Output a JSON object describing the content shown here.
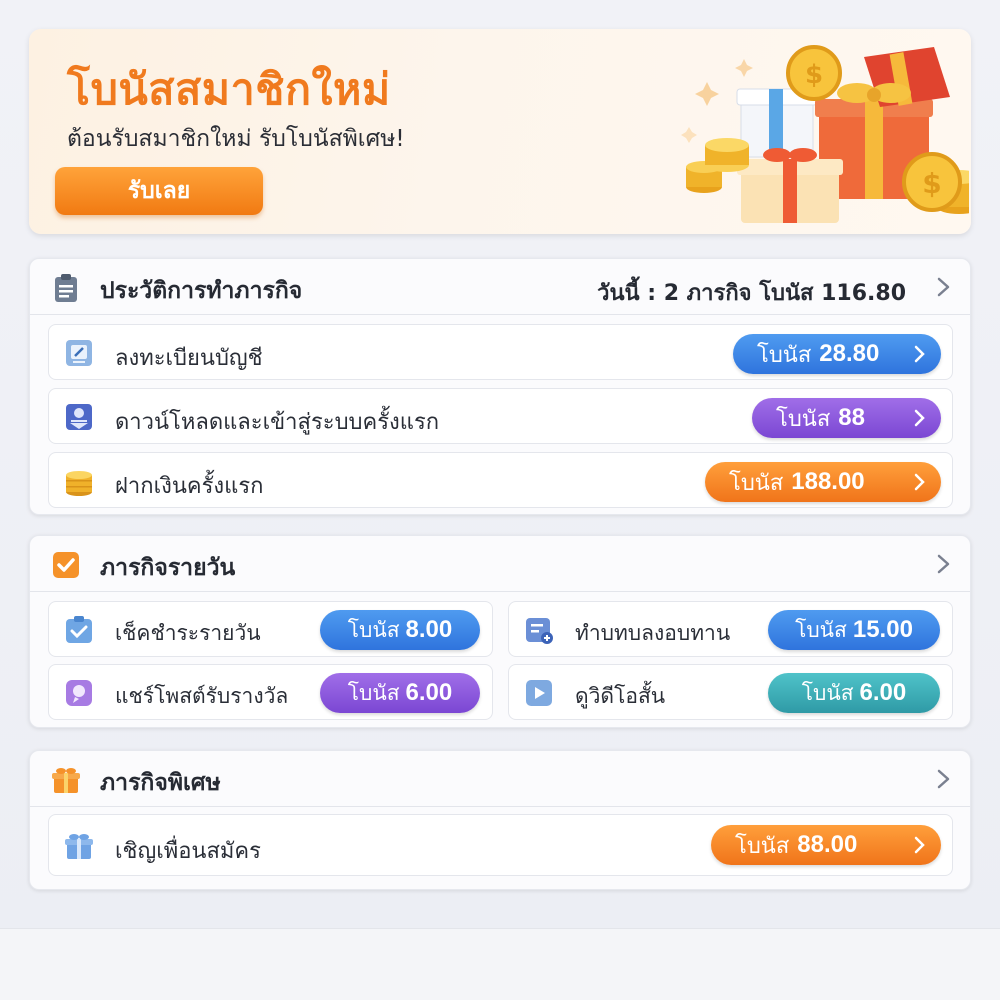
{
  "banner": {
    "title": "โบนัสสมาชิกใหม่",
    "subtitle": "ต้อนรับสมาชิกใหม่ รับโบนัสพิเศษ!",
    "claim_label": "รับเลย"
  },
  "history": {
    "title": "ประวัติการทำภารกิจ",
    "summary": "วันนี้ : 2 ภารกิจ โบนัส 116.80",
    "items": [
      {
        "label": "ลงทะเบียนบัญชี",
        "bonus_word": "โบนัส",
        "bonus": "28.80",
        "color": "#3a82e6",
        "icon": "register-icon"
      },
      {
        "label": "ดาวน์โหลดและเข้าสู่ระบบครั้งแรก",
        "bonus_word": "โบนัส",
        "bonus": "88",
        "color": "#8a55dc",
        "icon": "download-icon"
      },
      {
        "label": "ฝากเงินครั้งแรก",
        "bonus_word": "โบนัส",
        "bonus": "188.00",
        "color": "#f5831f",
        "icon": "coins-icon"
      }
    ]
  },
  "daily": {
    "title": "ภารกิจรายวัน",
    "items": [
      {
        "label": "เช็คชำระรายวัน",
        "bonus_word": "โบนัส",
        "bonus": "8.00",
        "color": "#3a82e6",
        "icon": "checkin-icon"
      },
      {
        "label": "ทำบทบลงอบทาน",
        "bonus_word": "โบนัส",
        "bonus": "15.00",
        "color": "#3a82e6",
        "icon": "task-icon"
      },
      {
        "label": "แชร์โพสต์รับรางวัล",
        "bonus_word": "โบนัส",
        "bonus": "6.00",
        "color": "#8a55dc",
        "icon": "share-icon"
      },
      {
        "label": "ดูวิดีโอสั้น",
        "bonus_word": "โบนัส",
        "bonus": "6.00",
        "color": "#36a9b2",
        "icon": "video-icon"
      }
    ]
  },
  "special": {
    "title": "ภารกิจพิเศษ",
    "items": [
      {
        "label": "เชิญเพื่อนสมัคร",
        "bonus_word": "โบนัส",
        "bonus": "88.00",
        "color": "#f5831f",
        "icon": "gift-icon"
      }
    ]
  }
}
